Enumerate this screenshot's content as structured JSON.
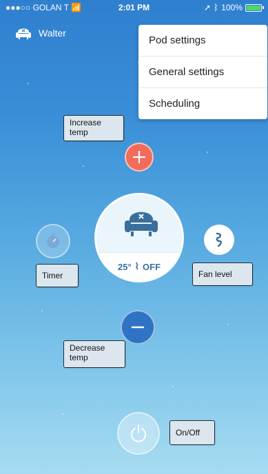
{
  "status": {
    "carrier": "●●●○○ GOLAN T",
    "time": "2:01 PM",
    "battery": "100%"
  },
  "user": {
    "name": "Walter",
    "icon": "armchair-icon"
  },
  "menu": {
    "items": [
      "Pod settings",
      "General settings",
      "Scheduling"
    ]
  },
  "controls": {
    "increase_label": "Increase temp",
    "decrease_label": "Decrease temp",
    "timer_label": "Timer",
    "fan_label": "Fan level",
    "onoff_label": "On/Off",
    "temperature": "25°",
    "fan_state": "OFF"
  },
  "colors": {
    "increase": "#f26b5b",
    "decrease": "#2f74c4",
    "accent": "#3a6f9d"
  }
}
